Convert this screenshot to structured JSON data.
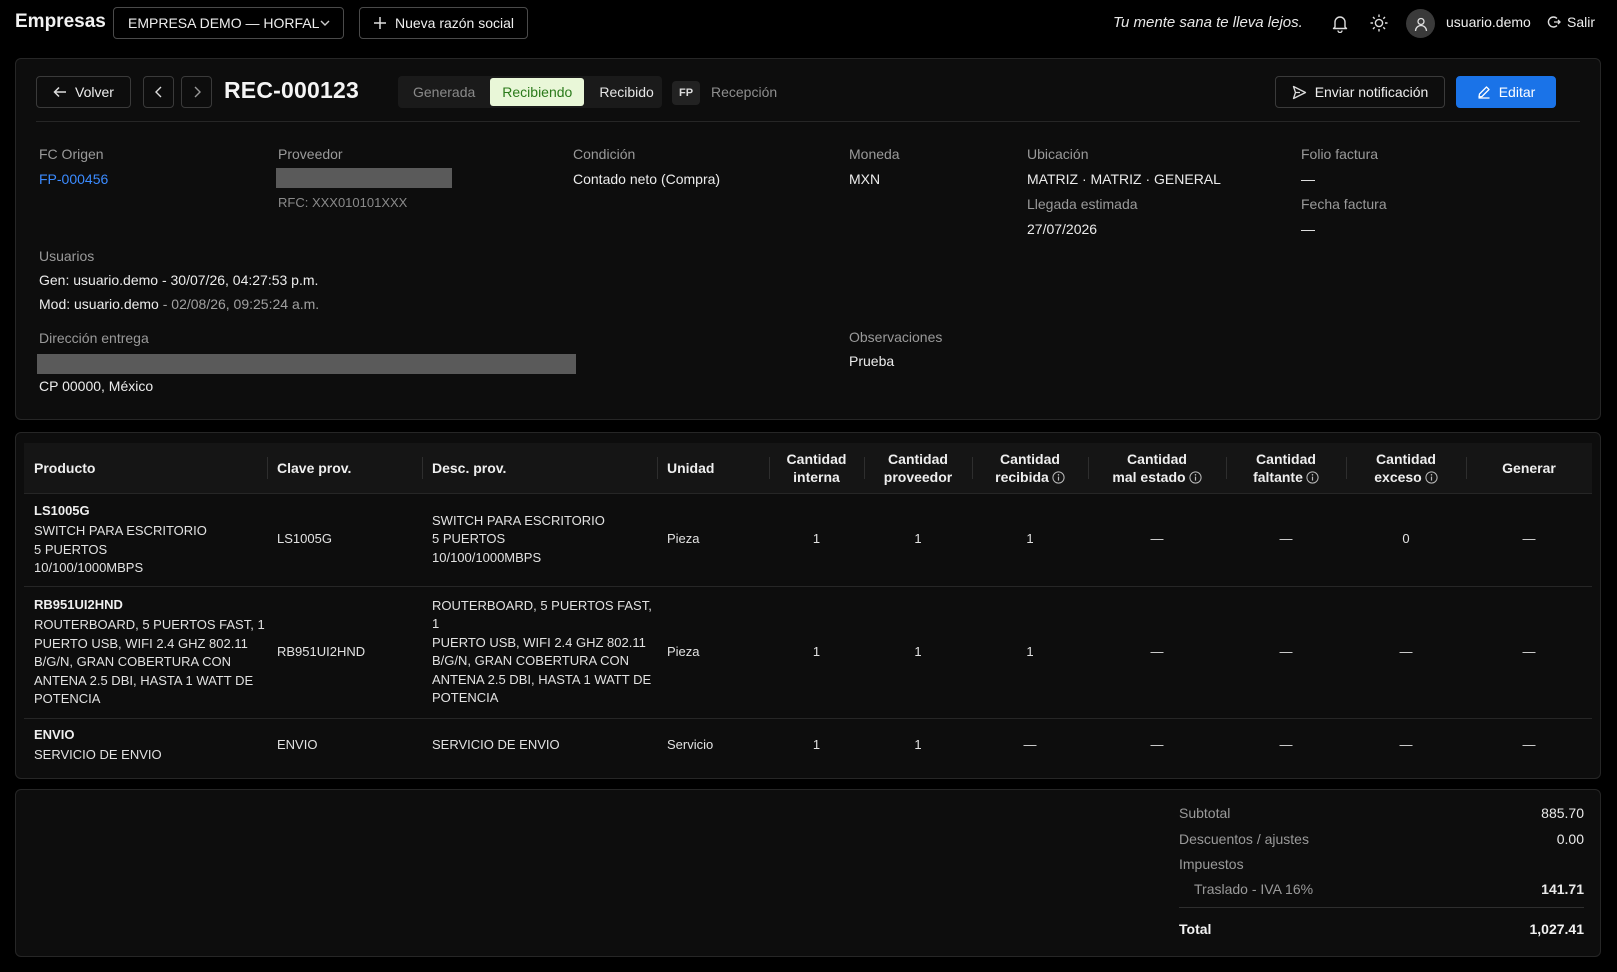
{
  "topbar": {
    "brand": "Empresas",
    "company": "EMPRESA DEMO — HORFAL",
    "new_company": "Nueva razón social",
    "slogan": "Tu mente sana te lleva lejos.",
    "username": "usuario.demo",
    "logout": "Salir"
  },
  "toolbar": {
    "back": "Volver",
    "doc_id": "REC-000123",
    "statuses": [
      "Generada",
      "Recibiendo",
      "Recibido"
    ],
    "active_status": "Recibiendo",
    "fp_badge": "FP",
    "fp_label": "Recepción",
    "notify": "Enviar notificación",
    "edit": "Editar"
  },
  "details": {
    "fc_origen_label": "FC Origen",
    "fc_origen": "FP-000456",
    "proveedor_label": "Proveedor",
    "rfc": "RFC: XXX010101XXX",
    "condicion_label": "Condición",
    "condicion": "Contado neto (Compra)",
    "moneda_label": "Moneda",
    "moneda": "MXN",
    "ubicacion_label": "Ubicación",
    "ubicacion": "MATRIZ · MATRIZ · GENERAL",
    "llegada_label": "Llegada estimada",
    "llegada": "27/07/2026",
    "folio_label": "Folio factura",
    "folio": "—",
    "fecha_label": "Fecha factura",
    "fecha": "—",
    "usuarios_label": "Usuarios",
    "gen_prefix": "Gen: usuario.demo",
    "gen_date": " - 30/07/26, 04:27:53 p.m.",
    "mod_prefix": "Mod: usuario.demo",
    "mod_date": " - 02/08/26, 09:25:24 a.m.",
    "direccion_label": "Dirección entrega",
    "cp": "CP 00000, México",
    "obs_label": "Observaciones",
    "obs": "Prueba"
  },
  "table": {
    "headers": {
      "producto": "Producto",
      "clave": "Clave prov.",
      "desc": "Desc. prov.",
      "unidad": "Unidad",
      "interna_1": "Cantidad",
      "interna_2": "interna",
      "proveedor_1": "Cantidad",
      "proveedor_2": "proveedor",
      "recibida_1": "Cantidad",
      "recibida_2": "recibida",
      "malestado_1": "Cantidad",
      "malestado_2": "mal estado",
      "faltante_1": "Cantidad",
      "faltante_2": "faltante",
      "exceso_1": "Cantidad",
      "exceso_2": "exceso",
      "generar": "Generar"
    },
    "rows": [
      {
        "code": "LS1005G",
        "name": [
          "SWITCH PARA ESCRITORIO",
          "5 PUERTOS",
          "10/100/1000MBPS"
        ],
        "clave": "LS1005G",
        "desc": [
          "SWITCH PARA ESCRITORIO",
          "5 PUERTOS",
          "10/100/1000MBPS"
        ],
        "unidad": "Pieza",
        "interna": "1",
        "proveedor": "1",
        "recibida": "1",
        "malestado": "—",
        "faltante": "—",
        "exceso": "0",
        "generar": "—"
      },
      {
        "code": "RB951UI2HND",
        "name": [
          "ROUTERBOARD, 5 PUERTOS FAST, 1",
          "PUERTO USB, WIFI 2.4 GHZ 802.11",
          "B/G/N, GRAN COBERTURA CON",
          "ANTENA 2.5 DBI, HASTA 1 WATT DE",
          "POTENCIA"
        ],
        "clave": "RB951UI2HND",
        "desc": [
          "ROUTERBOARD, 5 PUERTOS FAST, 1",
          "PUERTO USB, WIFI 2.4 GHZ 802.11",
          "B/G/N, GRAN COBERTURA CON",
          "ANTENA 2.5 DBI, HASTA 1 WATT DE",
          "POTENCIA"
        ],
        "unidad": "Pieza",
        "interna": "1",
        "proveedor": "1",
        "recibida": "1",
        "malestado": "—",
        "faltante": "—",
        "exceso": "—",
        "generar": "—"
      },
      {
        "code": "ENVIO",
        "name": [
          "SERVICIO DE ENVIO"
        ],
        "clave": "ENVIO",
        "desc": [
          "SERVICIO DE ENVIO"
        ],
        "unidad": "Servicio",
        "interna": "1",
        "proveedor": "1",
        "recibida": "—",
        "malestado": "—",
        "faltante": "—",
        "exceso": "—",
        "generar": "—"
      }
    ]
  },
  "totals": {
    "subtotal_label": "Subtotal",
    "subtotal": "885.70",
    "desc_label": "Descuentos / ajustes",
    "desc": "0.00",
    "impuestos_label": "Impuestos",
    "traslado_label": "Traslado - IVA 16%",
    "traslado": "141.71",
    "total_label": "Total",
    "total": "1,027.41"
  },
  "colors": {
    "accent": "#1a73e8",
    "link": "#3b8bff",
    "status_active_bg": "#e9f7d8",
    "status_active_fg": "#2a7a1a"
  },
  "icons": [
    "chevron-down-icon",
    "plus-icon",
    "bell-icon",
    "sun-icon",
    "user-icon",
    "logout-icon",
    "arrow-left-icon",
    "chevron-left-icon",
    "chevron-right-icon",
    "send-icon",
    "pencil-icon",
    "info-icon"
  ]
}
